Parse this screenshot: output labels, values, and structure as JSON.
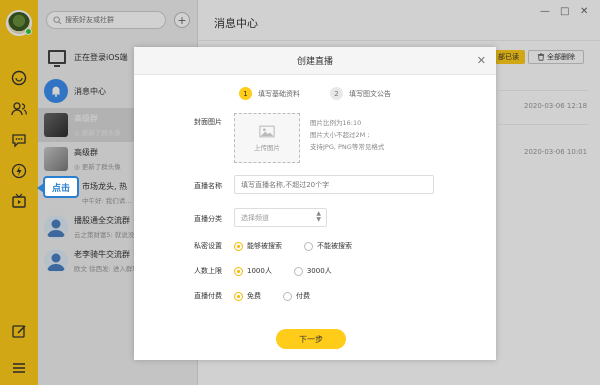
{
  "sidebar": {
    "search_placeholder": "搜索好友或社群",
    "add_label": "+",
    "tooltip": "点击",
    "items": [
      {
        "title": "正在登录iOS端",
        "subtitle": ""
      },
      {
        "title": "消息中心",
        "subtitle": ""
      },
      {
        "title": "高级群",
        "subtitle": "◎ 更新了群头像"
      },
      {
        "title": "高级群",
        "subtitle": "◎ 更新了群头像"
      },
      {
        "title": "市场龙头, 热",
        "subtitle": "中午好: 我们请..."
      },
      {
        "title": "播股通全交流群",
        "subtitle": "云之策财富5: 就说没"
      },
      {
        "title": "老李骑牛交流群",
        "subtitle": "欧文 徐西发: 进入群聊"
      }
    ]
  },
  "main": {
    "title": "消息中心",
    "mark_read": "部已读",
    "delete_all": "全部删除",
    "times": [
      "2020-03-06 12:18",
      "2020-03-06 10:01"
    ],
    "window_controls": [
      "—",
      "□",
      "✕"
    ]
  },
  "modal": {
    "title": "创建直播",
    "close": "✕",
    "steps": [
      {
        "num": "1",
        "label": "填写基础资料"
      },
      {
        "num": "2",
        "label": "填写图文公告"
      }
    ],
    "cover_label": "封面图片",
    "upload_text": "上传图片",
    "cover_hints": [
      "图片比例为16:10",
      "图片大小不超过2M ;",
      "支持JPG, PNG等常见格式"
    ],
    "name_label": "直播名称",
    "name_placeholder": "填写直播名称,不超过20个字",
    "category_label": "直播分类",
    "category_placeholder": "选择频道",
    "privacy_label": "私密设置",
    "privacy_options": [
      "能够被搜索",
      "不能被搜索"
    ],
    "limit_label": "人数上限",
    "limit_options": [
      "1000人",
      "3000人"
    ],
    "fee_label": "直播付费",
    "fee_options": [
      "免费",
      "付费"
    ],
    "next_button": "下一步"
  },
  "colors": {
    "accent": "#ffcc1a",
    "tooltip": "#2a7fd0"
  }
}
